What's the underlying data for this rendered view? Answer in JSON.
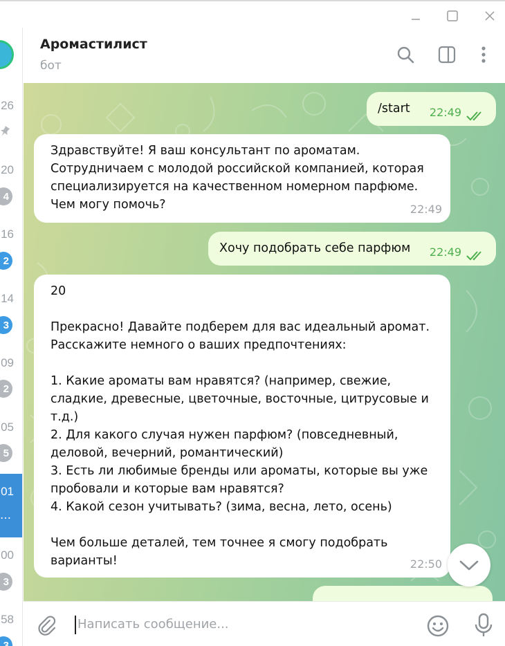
{
  "window": {
    "controls": [
      "minimize-icon",
      "maximize-icon",
      "close-icon"
    ]
  },
  "sidebar": {
    "items": [
      {
        "time": "26",
        "pinned": true
      },
      {
        "time": "20",
        "badge": "4",
        "badge_color": "#b4b8bc"
      },
      {
        "time": "16",
        "badge": "2",
        "badge_color": "#3d9be3"
      },
      {
        "time": "14",
        "badge": "3",
        "badge_color": "#3d9be3"
      },
      {
        "time": "09",
        "badge": "2",
        "badge_color": "#b4b8bc"
      },
      {
        "time": "05",
        "badge": "5",
        "badge_color": "#b4b8bc"
      },
      {
        "time": "01",
        "selected": true,
        "preview": "…"
      },
      {
        "time": "00",
        "badge": "3",
        "badge_color": "#b4b8bc"
      },
      {
        "time": "58",
        "badge": "3",
        "badge_color": "#3d9be3"
      }
    ]
  },
  "header": {
    "title": "Аромастилист",
    "subtitle": "бот"
  },
  "messages": [
    {
      "direction": "out",
      "text": "/start",
      "time": "22:49",
      "read": true
    },
    {
      "direction": "in",
      "text": "Здравствуйте! Я ваш консультант по ароматам.\nСотрудничаем с молодой российской компанией, которая\nспециализируется на качественном номерном парфюме.\nЧем могу помочь?",
      "time": "22:49"
    },
    {
      "direction": "out",
      "text": "Хочу подобрать себе парфюм",
      "time": "22:49",
      "read": true
    },
    {
      "direction": "in",
      "text": "20\n\nПрекрасно! Давайте подберем для вас идеальный аромат.\nРасскажите немного о ваших предпочтениях:\n\n1. Какие ароматы вам нравятся? (например, свежие,\nсладкие, древесные, цветочные, восточные, цитрусовые и\nт.д.)\n2. Для какого случая нужен парфюм? (повседневный,\nделовой, вечерний, романтический)\n3. Есть ли любимые бренды или ароматы, которые вы уже\nпробовали и которые вам нравятся?\n4. Какой сезон учитывать? (зима, весна, лето, осень)\n\nЧем больше деталей, тем точнее я смогу подобрать\nварианты!",
      "time": "22:50"
    }
  ],
  "composer": {
    "placeholder": "Написать сообщение...",
    "value": ""
  },
  "colors": {
    "accent": "#3a8fd8",
    "outgoing_bubble": "#effdde",
    "incoming_bubble": "#ffffff",
    "read_check": "#4fae4e"
  }
}
